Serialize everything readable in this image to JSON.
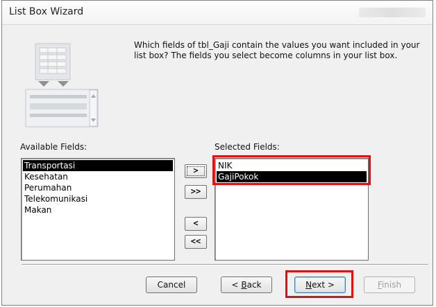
{
  "window": {
    "title": "List Box Wizard"
  },
  "question": "Which fields of tbl_Gaji contain the values you want included in your list box? The fields you select become columns in your list box.",
  "available": {
    "label": "Available Fields:",
    "items": [
      {
        "text": "Transportasi",
        "selected": true
      },
      {
        "text": "Kesehatan",
        "selected": false
      },
      {
        "text": "Perumahan",
        "selected": false
      },
      {
        "text": "Telekomunikasi",
        "selected": false
      },
      {
        "text": "Makan",
        "selected": false
      }
    ]
  },
  "selected": {
    "label": "Selected Fields:",
    "items": [
      {
        "text": "NIK",
        "selected": false
      },
      {
        "text": "GajiPokok",
        "selected": true
      }
    ]
  },
  "move_buttons": {
    "add_one": ">",
    "add_all": ">>",
    "remove_one": "<",
    "remove_all": "<<"
  },
  "buttons": {
    "cancel": "Cancel",
    "back_prefix": "< ",
    "back_key": "B",
    "back_rest": "ack",
    "next_key": "N",
    "next_rest": "ext >",
    "finish_key": "F",
    "finish_rest": "inish"
  },
  "colors": {
    "highlight": "#e01010",
    "selection": "#000000"
  }
}
